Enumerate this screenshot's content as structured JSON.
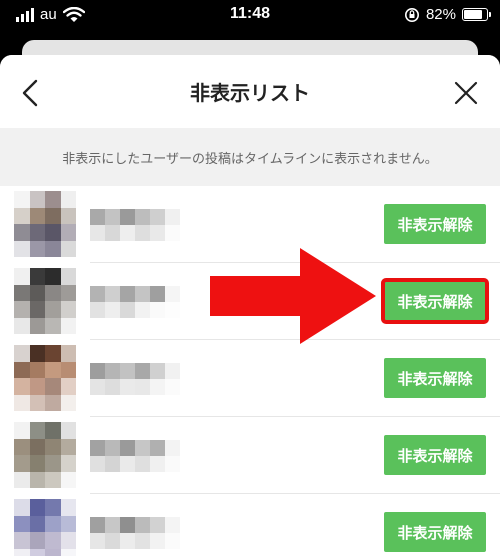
{
  "status_bar": {
    "carrier": "au",
    "time": "11:48",
    "battery_percent_label": "82%",
    "battery_level": 0.82
  },
  "header": {
    "title": "非表示リスト",
    "back_icon": "chevron-left-icon",
    "close_icon": "close-icon"
  },
  "notice": "非表示にしたユーザーの投稿はタイムラインに表示されません。",
  "rows": [
    {
      "button_label": "非表示解除",
      "avatar_palette": [
        "#f4f4f4",
        "#c9c3c3",
        "#9c8e8e",
        "#efefef",
        "#d6d0c9",
        "#9d8977",
        "#7e6d60",
        "#c9c3bd",
        "#8f8c94",
        "#6d6978",
        "#5a5667",
        "#b2adb6",
        "#e2e2e6",
        "#9b97a7",
        "#8a8698",
        "#dadada"
      ],
      "name_palette": [
        "#a9a9a9",
        "#c3c3c3",
        "#9a9a9a",
        "#bdbdbd",
        "#cfcfcf",
        "#f0f0f0",
        "#e7e7e7",
        "#d8d8d8",
        "#eeeeee",
        "#dedede",
        "#e9e9e9",
        "#fbfbfb"
      ]
    },
    {
      "button_label": "非表示解除",
      "avatar_palette": [
        "#f0f0f0",
        "#3a3a3a",
        "#2c2c2c",
        "#d9d9d9",
        "#7a7876",
        "#5d5b59",
        "#8a8785",
        "#9e9b98",
        "#b4b1ae",
        "#6b6866",
        "#a29f9b",
        "#d1cfcc",
        "#e8e8e8",
        "#9c9996",
        "#b9b7b4",
        "#f2f2f2"
      ],
      "name_palette": [
        "#b3b3b3",
        "#cfcfcf",
        "#a5a5a5",
        "#c4c4c4",
        "#9f9f9f",
        "#f5f5f5",
        "#e2e2e2",
        "#eeeeee",
        "#d9d9d9",
        "#f2f2f2",
        "#fafafa",
        "#fdfdfd"
      ]
    },
    {
      "button_label": "非表示解除",
      "avatar_palette": [
        "#d8d2cf",
        "#4a3024",
        "#6a4431",
        "#cdbdb2",
        "#8d6a55",
        "#a57b61",
        "#c49a7f",
        "#b88d73",
        "#d4b3a0",
        "#c09885",
        "#a6887a",
        "#e2cfc5",
        "#efe8e4",
        "#d3c0b6",
        "#bfaaa0",
        "#f3efec"
      ],
      "name_palette": [
        "#9d9d9d",
        "#b5b5b5",
        "#c2c2c2",
        "#a8a8a8",
        "#d0d0d0",
        "#f1f1f1",
        "#e4e4e4",
        "#dddddd",
        "#eaeaea",
        "#e8e8e8",
        "#f4f4f4",
        "#fbfbfb"
      ]
    },
    {
      "button_label": "非表示解除",
      "avatar_palette": [
        "#f2f2f2",
        "#8d8f86",
        "#6f7168",
        "#e1e1e1",
        "#9b8f7e",
        "#7b6f60",
        "#8f8574",
        "#b3ab9e",
        "#a39b8c",
        "#86806f",
        "#9b9689",
        "#d5d2cb",
        "#ebebeb",
        "#b9b5ab",
        "#ccc8bf",
        "#f6f6f6"
      ],
      "name_palette": [
        "#a2a2a2",
        "#b9b9b9",
        "#9a9a9a",
        "#c6c6c6",
        "#b0b0b0",
        "#f3f3f3",
        "#e0e0e0",
        "#d4d4d4",
        "#eaeaea",
        "#dfdfdf",
        "#f0f0f0",
        "#fafafa"
      ]
    },
    {
      "button_label": "非表示解除",
      "avatar_palette": [
        "#dcdce8",
        "#5a5f9c",
        "#7479ad",
        "#e6e6ef",
        "#8c90bf",
        "#6a6fa6",
        "#9da1c8",
        "#b8bbd7",
        "#c8c4d4",
        "#aaa5bb",
        "#bfbad0",
        "#e3e1ea",
        "#f0eff4",
        "#d0cce0",
        "#bcb6ce",
        "#f6f6f9"
      ],
      "name_palette": [
        "#a0a0a0",
        "#c7c7c7",
        "#8f8f8f",
        "#bbbbbb",
        "#d2d2d2",
        "#f4f4f4",
        "#e6e6e6",
        "#dadada",
        "#ececec",
        "#e2e2e2",
        "#f2f2f2",
        "#fbfbfb"
      ]
    }
  ],
  "highlight": {
    "row_index": 1,
    "outline_color": "#e8100f",
    "arrow_color": "#ee1111",
    "arrow_icon": "pointing-arrow-icon"
  },
  "colors": {
    "button_green": "#5ac15b",
    "notice_bg": "#f1f1f1"
  }
}
